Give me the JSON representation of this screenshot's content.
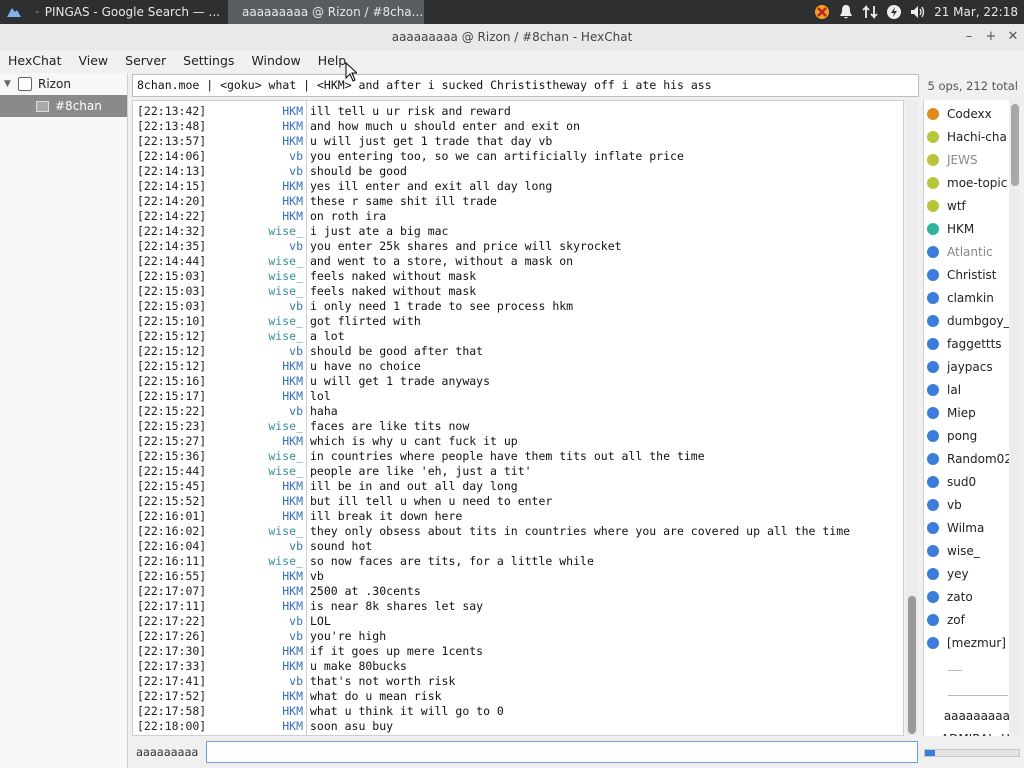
{
  "taskbar": {
    "task1_label": "PINGAS - Google Search — ...",
    "task2_label": "aaaaaaaaa @ Rizon / #8cha...",
    "clock": "21 Mar, 22:18"
  },
  "window": {
    "title": "aaaaaaaaa @ Rizon / #8chan - HexChat"
  },
  "menu": {
    "items": [
      "HexChat",
      "View",
      "Server",
      "Settings",
      "Window",
      "Help"
    ]
  },
  "tree": {
    "server": "Rizon",
    "channel": "#8chan"
  },
  "topic": "8chan.moe | <goku> what | <HKM> and after i sucked Christistheway off i ate his ass",
  "user_count": "5 ops, 212 total",
  "messages": [
    {
      "time": "[22:13:42]",
      "nick": "HKM",
      "text": "ill tell u ur risk and reward"
    },
    {
      "time": "[22:13:48]",
      "nick": "HKM",
      "text": "and how much u should enter and exit on"
    },
    {
      "time": "[22:13:57]",
      "nick": "HKM",
      "text": "u will just get 1 trade that day vb"
    },
    {
      "time": "[22:14:06]",
      "nick": "vb",
      "text": "you entering too, so we can artificially inflate price"
    },
    {
      "time": "[22:14:13]",
      "nick": "vb",
      "text": "should be good"
    },
    {
      "time": "[22:14:15]",
      "nick": "HKM",
      "text": "yes ill enter and exit all day long"
    },
    {
      "time": "[22:14:20]",
      "nick": "HKM",
      "text": "these r same shit ill trade"
    },
    {
      "time": "[22:14:22]",
      "nick": "HKM",
      "text": "on roth ira"
    },
    {
      "time": "[22:14:32]",
      "nick": "wise_",
      "text": "i just ate a big mac"
    },
    {
      "time": "[22:14:35]",
      "nick": "vb",
      "text": "you enter 25k shares and price will skyrocket"
    },
    {
      "time": "[22:14:44]",
      "nick": "wise_",
      "text": "and went to a store, without a mask on"
    },
    {
      "time": "[22:15:03]",
      "nick": "wise_",
      "text": "feels naked without mask"
    },
    {
      "time": "[22:15:03]",
      "nick": "wise_",
      "text": "feels naked without mask"
    },
    {
      "time": "[22:15:03]",
      "nick": "vb",
      "text": "i only need 1 trade to see process hkm"
    },
    {
      "time": "[22:15:10]",
      "nick": "wise_",
      "text": "got flirted with"
    },
    {
      "time": "[22:15:12]",
      "nick": "wise_",
      "text": "a lot"
    },
    {
      "time": "[22:15:12]",
      "nick": "vb",
      "text": "should be good after that"
    },
    {
      "time": "[22:15:12]",
      "nick": "HKM",
      "text": "u have no choice"
    },
    {
      "time": "[22:15:16]",
      "nick": "HKM",
      "text": "u will get 1 trade anyways"
    },
    {
      "time": "[22:15:17]",
      "nick": "HKM",
      "text": "lol"
    },
    {
      "time": "[22:15:22]",
      "nick": "vb",
      "text": "haha"
    },
    {
      "time": "[22:15:23]",
      "nick": "wise_",
      "text": "faces are like tits now"
    },
    {
      "time": "[22:15:27]",
      "nick": "HKM",
      "text": "which is why u cant fuck it up"
    },
    {
      "time": "[22:15:36]",
      "nick": "wise_",
      "text": "in countries where people have them tits out all the time"
    },
    {
      "time": "[22:15:44]",
      "nick": "wise_",
      "text": "people are like 'eh, just a tit'"
    },
    {
      "time": "[22:15:45]",
      "nick": "HKM",
      "text": "ill be in and out all day long"
    },
    {
      "time": "[22:15:52]",
      "nick": "HKM",
      "text": "but ill tell u when u need to enter"
    },
    {
      "time": "[22:16:01]",
      "nick": "HKM",
      "text": "ill break it down here"
    },
    {
      "time": "[22:16:02]",
      "nick": "wise_",
      "text": "they only obsess about tits in countries where you are covered up all the time"
    },
    {
      "time": "[22:16:04]",
      "nick": "vb",
      "text": "sound hot"
    },
    {
      "time": "[22:16:11]",
      "nick": "wise_",
      "text": "so now faces are tits, for a little while"
    },
    {
      "time": "[22:16:55]",
      "nick": "HKM",
      "text": "vb"
    },
    {
      "time": "[22:17:07]",
      "nick": "HKM",
      "text": "2500 at .30cents"
    },
    {
      "time": "[22:17:11]",
      "nick": "HKM",
      "text": "is near 8k shares let say"
    },
    {
      "time": "[22:17:22]",
      "nick": "vb",
      "text": "LOL"
    },
    {
      "time": "[22:17:26]",
      "nick": "vb",
      "text": "you're high"
    },
    {
      "time": "[22:17:30]",
      "nick": "HKM",
      "text": "if it goes up mere 1cents"
    },
    {
      "time": "[22:17:33]",
      "nick": "HKM",
      "text": "u make 80bucks"
    },
    {
      "time": "[22:17:41]",
      "nick": "vb",
      "text": "that's not worth risk"
    },
    {
      "time": "[22:17:52]",
      "nick": "HKM",
      "text": "what do u mean risk"
    },
    {
      "time": "[22:17:58]",
      "nick": "HKM",
      "text": "what u think it will go to 0"
    },
    {
      "time": "[22:18:00]",
      "nick": "HKM",
      "text": "soon asu buy"
    }
  ],
  "users": [
    {
      "name": "Codexx",
      "color": "#e08a1e"
    },
    {
      "name": "Hachi-cha",
      "color": "#b8c43a"
    },
    {
      "name": "JEWS",
      "color": "#b8c43a",
      "away": true
    },
    {
      "name": "moe-topic",
      "color": "#b8c43a"
    },
    {
      "name": "wtf",
      "color": "#b8c43a"
    },
    {
      "name": "HKM",
      "color": "#2fb59b"
    },
    {
      "name": "Atlantic",
      "color": "#3b7dd8",
      "away": true
    },
    {
      "name": "Christist",
      "color": "#3b7dd8"
    },
    {
      "name": "clamkin",
      "color": "#3b7dd8"
    },
    {
      "name": "dumbgoy_",
      "color": "#3b7dd8"
    },
    {
      "name": "faggettts",
      "color": "#3b7dd8"
    },
    {
      "name": "jaypacs",
      "color": "#3b7dd8"
    },
    {
      "name": "lal",
      "color": "#3b7dd8"
    },
    {
      "name": "Miep",
      "color": "#3b7dd8"
    },
    {
      "name": "pong",
      "color": "#3b7dd8"
    },
    {
      "name": "Random024",
      "color": "#3b7dd8"
    },
    {
      "name": "sud0",
      "color": "#3b7dd8"
    },
    {
      "name": "vb",
      "color": "#3b7dd8"
    },
    {
      "name": "Wilma",
      "color": "#3b7dd8"
    },
    {
      "name": "wise_",
      "color": "#3b7dd8"
    },
    {
      "name": "yey",
      "color": "#3b7dd8"
    },
    {
      "name": "zato",
      "color": "#3b7dd8"
    },
    {
      "name": "zof",
      "color": "#3b7dd8"
    },
    {
      "name": "[mezmur]",
      "color": "#3b7dd8"
    },
    {
      "name": "aaaaaaaaa",
      "color": ""
    },
    {
      "name": "ADMIRAL_H",
      "color": ""
    }
  ],
  "input": {
    "nick": "aaaaaaaaa",
    "value": ""
  }
}
